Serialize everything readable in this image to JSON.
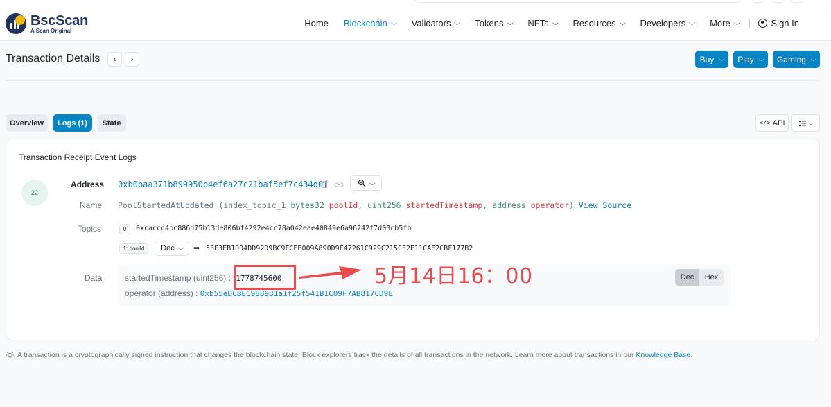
{
  "header": {
    "brand": "BscScan",
    "tagline": "A Scan Original",
    "nav": [
      {
        "label": "Home",
        "dropdown": false,
        "active": false
      },
      {
        "label": "Blockchain",
        "dropdown": true,
        "active": true
      },
      {
        "label": "Validators",
        "dropdown": true,
        "active": false
      },
      {
        "label": "Tokens",
        "dropdown": true,
        "active": false
      },
      {
        "label": "NFTs",
        "dropdown": true,
        "active": false
      },
      {
        "label": "Resources",
        "dropdown": true,
        "active": false
      },
      {
        "label": "Developers",
        "dropdown": true,
        "active": false
      },
      {
        "label": "More",
        "dropdown": true,
        "active": false
      }
    ],
    "signin": "Sign In"
  },
  "page": {
    "title": "Transaction Details",
    "prev": "‹",
    "next": "›",
    "buttons": [
      "Buy",
      "Play",
      "Gaming"
    ]
  },
  "tabs": {
    "overview": "Overview",
    "logs": "Logs (1)",
    "state": "State",
    "api": "API"
  },
  "logs": {
    "card_title": "Transaction Receipt Event Logs",
    "index": "22",
    "address_label": "Address",
    "address": "0xb0baa371b899950b4ef6a27c21baf5ef7c434d0f",
    "name_label": "Name",
    "name": {
      "event": "PoolStartedAtUpdated",
      "open": "(",
      "param1_prefix": "index_topic_1",
      "param1_type": "bytes32",
      "param1_name": "poolId",
      "sep1": ",",
      "param2_type": "uint256",
      "param2_name": "startedTimestamp",
      "sep2": ",",
      "param3_type": "address",
      "param3_name": "operator",
      "close": ")",
      "view_source": "View Source"
    },
    "topics_label": "Topics",
    "topics": [
      {
        "badge": "0",
        "value": "0xcaccc4bc886d75b13de806bf4292e4cc78a042eae40849e6a96242f7d03cb5fb"
      },
      {
        "badge": "1: poolId",
        "format": "Dec",
        "value": "53F3EB1004DD92D9BC9FCEB009A890D9F47261C929C215CE2E11CAE2CBF177B2"
      }
    ],
    "data_label": "Data",
    "data": {
      "field1_label": "startedTimestamp (uint256) :",
      "field1_value": "1778745600",
      "field2_label": "operator (address) :",
      "field2_value": "0xb55eDCBEC988931a1f25f541B1C09F7AB817CD9E",
      "toggle": [
        "Dec",
        "Hex"
      ]
    }
  },
  "annotation": {
    "text": "5月14日16：00",
    "color": "#e94c4f"
  },
  "footer": {
    "text": "A transaction is a cryptographically signed instruction that changes the blockchain state. Block explorers track the details of all transactions in the network. Learn more about transactions in our",
    "link": "Knowledge Base",
    "end": "."
  },
  "colors": {
    "accent": "#0784c3",
    "brand": "#21325b",
    "type_green": "#3d8c76",
    "param_red": "#dc3545"
  }
}
